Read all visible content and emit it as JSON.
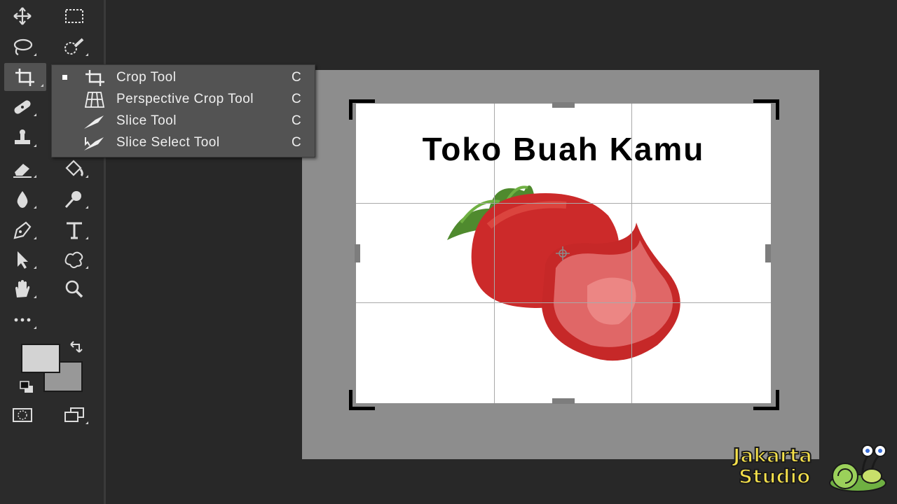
{
  "toolbar": {
    "tools": [
      {
        "name": "move-icon"
      },
      {
        "name": "marquee-icon"
      },
      {
        "name": "lasso-icon"
      },
      {
        "name": "quick-selection-icon"
      },
      {
        "name": "crop-icon"
      },
      {
        "name": "healing-icon"
      },
      {
        "name": "stamp-icon"
      },
      {
        "name": "eraser-icon"
      },
      {
        "name": "paint-bucket-icon"
      },
      {
        "name": "blur-icon"
      },
      {
        "name": "dodge-icon"
      },
      {
        "name": "pen-icon"
      },
      {
        "name": "type-icon"
      },
      {
        "name": "path-selection-icon"
      },
      {
        "name": "custom-shape-icon"
      },
      {
        "name": "hand-icon"
      },
      {
        "name": "zoom-icon"
      },
      {
        "name": "more-tools-icon"
      }
    ],
    "foreground_color": "#d3d3d3",
    "background_color": "#989898"
  },
  "flyout": {
    "items": [
      {
        "label": "Crop Tool",
        "shortcut": "C",
        "icon": "crop-icon",
        "selected": true
      },
      {
        "label": "Perspective Crop Tool",
        "shortcut": "C",
        "icon": "perspective-crop-icon",
        "selected": false
      },
      {
        "label": "Slice Tool",
        "shortcut": "C",
        "icon": "slice-icon",
        "selected": false
      },
      {
        "label": "Slice Select Tool",
        "shortcut": "C",
        "icon": "slice-select-icon",
        "selected": false
      }
    ]
  },
  "canvas": {
    "image_title": "Toko Buah Kamu"
  },
  "watermark": {
    "line1": "Jakarta",
    "line2": "Studio"
  },
  "colors": {
    "panel": "#2b2b2b",
    "flyout": "#535353",
    "canvas_bg": "#8d8d8d",
    "strawberry": "#cc2a2a",
    "leaf": "#4f8a2e"
  }
}
